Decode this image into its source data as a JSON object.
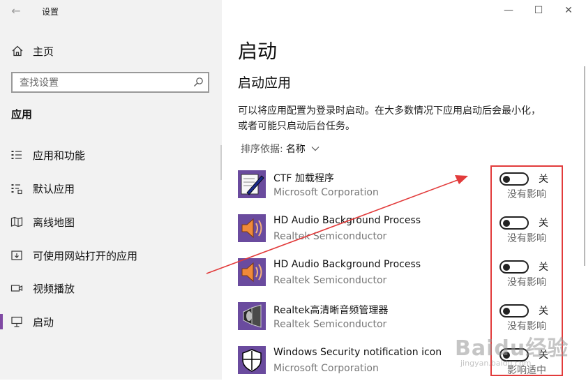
{
  "window": {
    "title": "设置",
    "controls": {
      "minimize": "—",
      "maximize": "☐",
      "close": "✕"
    }
  },
  "sidebar": {
    "home_label": "主页",
    "search_placeholder": "查找设置",
    "section_heading": "应用",
    "items": [
      {
        "label": "应用和功能",
        "icon": "apps-features-icon",
        "active": false
      },
      {
        "label": "默认应用",
        "icon": "default-apps-icon",
        "active": false
      },
      {
        "label": "离线地图",
        "icon": "offline-maps-icon",
        "active": false
      },
      {
        "label": "可使用网站打开的应用",
        "icon": "apps-for-websites-icon",
        "active": false
      },
      {
        "label": "视频播放",
        "icon": "video-playback-icon",
        "active": false
      },
      {
        "label": "启动",
        "icon": "startup-icon",
        "active": true
      }
    ]
  },
  "main": {
    "title": "启动",
    "subtitle": "启动应用",
    "description": "可以将应用配置为登录时启动。在大多数情况下应用启动后会最小化，或者可能只启动后台任务。",
    "sort_label": "排序依据:",
    "sort_value": "名称",
    "apps": [
      {
        "name": "CTF 加载程序",
        "publisher": "Microsoft Corporation",
        "state": "关",
        "impact": "没有影响",
        "icon": "ctf-loader-icon"
      },
      {
        "name": "HD Audio Background Process",
        "publisher": "Realtek Semiconductor",
        "state": "关",
        "impact": "没有影响",
        "icon": "speaker-icon"
      },
      {
        "name": "HD Audio Background Process",
        "publisher": "Realtek Semiconductor",
        "state": "关",
        "impact": "没有影响",
        "icon": "speaker-icon"
      },
      {
        "name": "Realtek高清晰音频管理器",
        "publisher": "Realtek Semiconductor",
        "state": "关",
        "impact": "没有影响",
        "icon": "realtek-audio-manager-icon"
      },
      {
        "name": "Windows Security notification icon",
        "publisher": "Microsoft Corporation",
        "state": "关",
        "impact": "影响适中",
        "icon": "shield-icon"
      }
    ]
  },
  "annotation": {
    "color": "#e23b3b"
  },
  "watermark": {
    "line1": "Baidu经验",
    "line2": "jingyan.baidu.com"
  },
  "colors": {
    "accent": "#7f49a3",
    "sidebar_bg": "#f2f2f2",
    "annotation_red": "#e23b3b"
  }
}
